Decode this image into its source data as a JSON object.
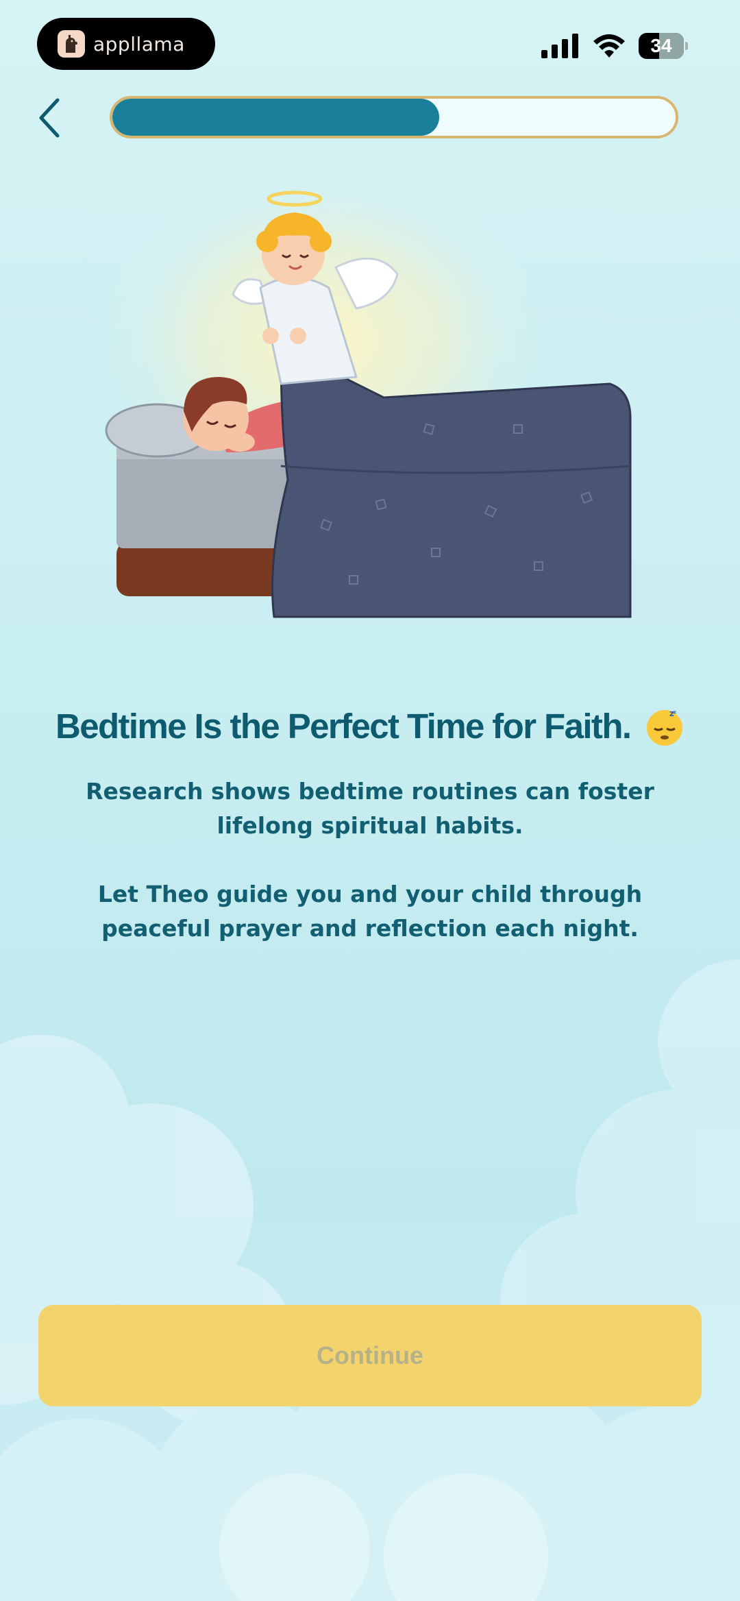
{
  "status_bar": {
    "brand": "appllama",
    "battery": "34"
  },
  "header": {
    "progress": 0.58,
    "colors": {
      "track": "#effcfd",
      "fill": "#1a7f9b",
      "border": "#d7b671"
    }
  },
  "illustration": {
    "description_icon": "angel-tucking-child-illustration"
  },
  "content": {
    "title": "Bedtime Is the Perfect Time for Faith.",
    "title_emoji": "sleeping-face-emoji",
    "paragraph_1": "Research shows bedtime routines can foster lifelong spiritual habits.",
    "paragraph_2": "Let Theo guide you and your child through peaceful prayer and reflection each night."
  },
  "footer": {
    "continue_label": "Continue",
    "colors": {
      "button": "#f3d46c",
      "label": "#b7b18a"
    }
  }
}
